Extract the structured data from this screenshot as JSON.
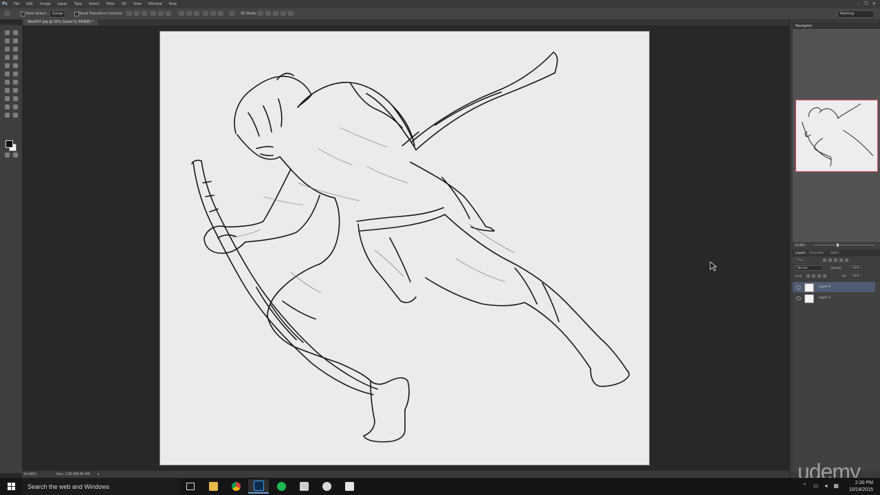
{
  "app": {
    "logo": "Ps"
  },
  "menu": [
    "File",
    "Edit",
    "Image",
    "Layer",
    "Type",
    "Select",
    "Filter",
    "3D",
    "View",
    "Window",
    "Help"
  ],
  "window_controls": [
    "–",
    "❐",
    "✕"
  ],
  "options_bar": {
    "auto_select_label": "Auto-Select:",
    "auto_select_value": "Group",
    "show_transform_label": "Show Transform Controls",
    "mode_3d_label": "3D Mode:",
    "workspace": "Painting"
  },
  "document": {
    "tab_title": "dleo007.jpg @ 25% (Layer 0, RGB/8) *"
  },
  "status_bar": {
    "zoom": "24.96%",
    "doc": "Doc: 139.9M/48.0M"
  },
  "navigator": {
    "title": "Navigator",
    "zoom": "24.96%"
  },
  "layers_panel": {
    "tabs": [
      "Layers",
      "Channels",
      "Paths"
    ],
    "kind_label": "Kind",
    "blend_mode": "Normal",
    "opacity_label": "Opacity:",
    "opacity_value": "100%",
    "lock_label": "Lock:",
    "fill_label": "Fill:",
    "fill_value": "100%",
    "layers": [
      {
        "name": "Layer 0",
        "selected": true
      },
      {
        "name": "Layer 1",
        "selected": false
      }
    ]
  },
  "taskbar": {
    "search_placeholder": "Search the web and Windows",
    "apps": [
      "task-view",
      "file-explorer",
      "chrome",
      "photoshop",
      "spotify",
      "app-5",
      "app-6",
      "app-7"
    ],
    "time": "2:30 PM",
    "date": "10/18/2015"
  },
  "watermark": "udemy",
  "colors": {
    "accent": "#6ea0d8",
    "selected_layer": "#4f5b70",
    "nav_frame": "#e05062"
  }
}
